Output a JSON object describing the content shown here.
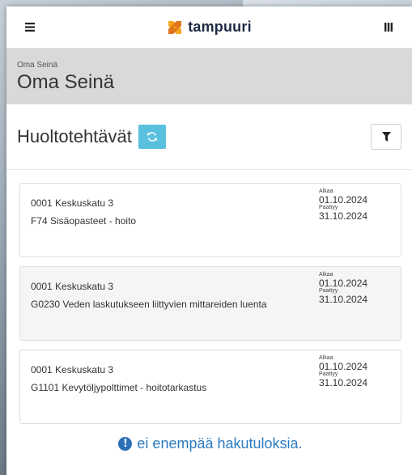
{
  "header": {
    "logo_text": "tampuuri",
    "menu_icon": "hamburger-icon",
    "apps_icon": "apps-icon"
  },
  "page": {
    "breadcrumb": "Oma Seinä",
    "title": "Oma Seinä"
  },
  "section": {
    "title": "Huoltotehtävät",
    "refresh_icon": "refresh-icon",
    "filter_icon": "filter-icon",
    "accent": "#5bc0de"
  },
  "tasks": [
    {
      "address": "0001 Keskuskatu 3",
      "task": "F74 Sisäopasteet - hoito",
      "start_label": "Alkaa",
      "start": "01.10.2024",
      "end_label": "Paattyy",
      "end": "31.10.2024"
    },
    {
      "address": "0001 Keskuskatu 3",
      "task": "G0230 Veden laskutukseen liittyvien mittareiden luenta",
      "start_label": "Alkaa",
      "start": "01.10.2024",
      "end_label": "Paattyy",
      "end": "31.10.2024"
    },
    {
      "address": "0001 Keskuskatu 3",
      "task": "G1101 Kevytöljypolttimet - hoitotarkastus",
      "start_label": "Alkaa",
      "start": "01.10.2024",
      "end_label": "Paattyy",
      "end": "31.10.2024"
    }
  ],
  "footer": {
    "no_more_text": "ei enempää hakutuloksia.",
    "info_icon": "info-icon",
    "color": "#2a7bc2"
  }
}
